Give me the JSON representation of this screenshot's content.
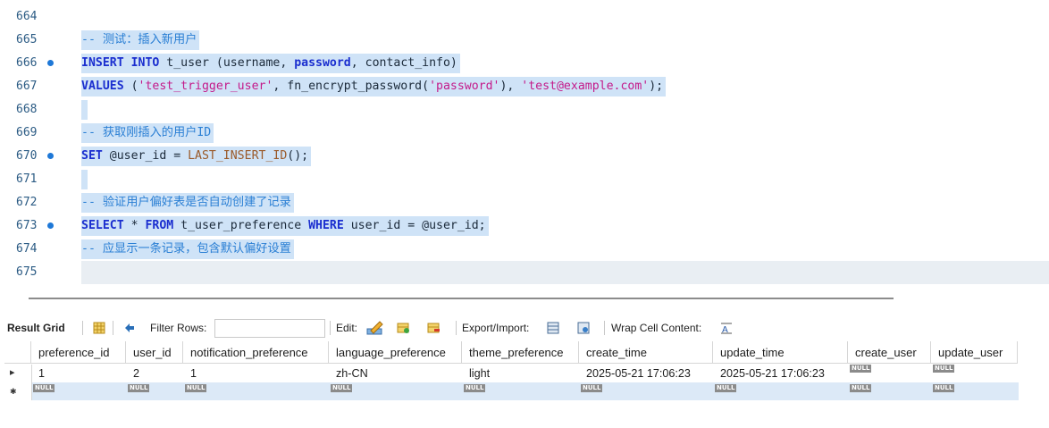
{
  "editor": {
    "lines": [
      {
        "num": "664",
        "dot": false,
        "tokens": []
      },
      {
        "num": "665",
        "dot": false,
        "tokens": [
          {
            "t": "-- 测试：插入新用户",
            "c": "cm"
          }
        ]
      },
      {
        "num": "666",
        "dot": true,
        "tokens": [
          {
            "t": "INSERT",
            "c": "kw"
          },
          {
            "t": " ",
            "c": "pu"
          },
          {
            "t": "INTO",
            "c": "kw"
          },
          {
            "t": " t_user (username, ",
            "c": "id"
          },
          {
            "t": "password",
            "c": "kw"
          },
          {
            "t": ", contact_info)",
            "c": "id"
          }
        ]
      },
      {
        "num": "667",
        "dot": false,
        "tokens": [
          {
            "t": "VALUES",
            "c": "kw"
          },
          {
            "t": " (",
            "c": "pu"
          },
          {
            "t": "'test_trigger_user'",
            "c": "st"
          },
          {
            "t": ", fn_encrypt_password(",
            "c": "id"
          },
          {
            "t": "'password'",
            "c": "st"
          },
          {
            "t": "), ",
            "c": "pu"
          },
          {
            "t": "'test@example.com'",
            "c": "st"
          },
          {
            "t": ");",
            "c": "pu"
          }
        ]
      },
      {
        "num": "668",
        "dot": false,
        "tokens": [],
        "selected_empty": true
      },
      {
        "num": "669",
        "dot": false,
        "tokens": [
          {
            "t": "-- 获取刚插入的用户ID",
            "c": "cm"
          }
        ]
      },
      {
        "num": "670",
        "dot": true,
        "tokens": [
          {
            "t": "SET",
            "c": "kw"
          },
          {
            "t": " @user_id = ",
            "c": "id"
          },
          {
            "t": "LAST_INSERT_ID",
            "c": "fn"
          },
          {
            "t": "();",
            "c": "pu"
          }
        ]
      },
      {
        "num": "671",
        "dot": false,
        "tokens": [],
        "selected_empty": true
      },
      {
        "num": "672",
        "dot": false,
        "tokens": [
          {
            "t": "-- 验证用户偏好表是否自动创建了记录",
            "c": "cm"
          }
        ]
      },
      {
        "num": "673",
        "dot": true,
        "tokens": [
          {
            "t": "SELECT",
            "c": "kw"
          },
          {
            "t": " * ",
            "c": "id"
          },
          {
            "t": "FROM",
            "c": "kw"
          },
          {
            "t": " t_user_preference ",
            "c": "id"
          },
          {
            "t": "WHERE",
            "c": "kw"
          },
          {
            "t": " user_id = @user_id;",
            "c": "id"
          }
        ]
      },
      {
        "num": "674",
        "dot": false,
        "tokens": [
          {
            "t": "-- 应显示一条记录，包含默认偏好设置",
            "c": "cm"
          }
        ]
      },
      {
        "num": "675",
        "dot": false,
        "tokens": [],
        "current": true
      }
    ]
  },
  "toolbar": {
    "result_grid": "Result Grid",
    "filter_rows": "Filter Rows:",
    "edit": "Edit:",
    "export_import": "Export/Import:",
    "wrap_cell": "Wrap Cell Content:"
  },
  "grid": {
    "columns": [
      "preference_id",
      "user_id",
      "notification_preference",
      "language_preference",
      "theme_preference",
      "create_time",
      "update_time",
      "create_user",
      "update_user"
    ],
    "rows": [
      [
        "1",
        "2",
        "1",
        "zh-CN",
        "light",
        "2025-05-21 17:06:23",
        "2025-05-21 17:06:23",
        "NULL",
        "NULL"
      ],
      [
        "NULL",
        "NULL",
        "NULL",
        "NULL",
        "NULL",
        "NULL",
        "NULL",
        "NULL",
        "NULL"
      ]
    ],
    "row_markers": [
      "▸",
      "✱"
    ]
  },
  "colors": {
    "keyword": "#1a2ecf",
    "comment": "#2a7fd4",
    "string": "#c41a8a",
    "selection": "#cfe3f7",
    "null_badge": "#8b8b8b"
  }
}
